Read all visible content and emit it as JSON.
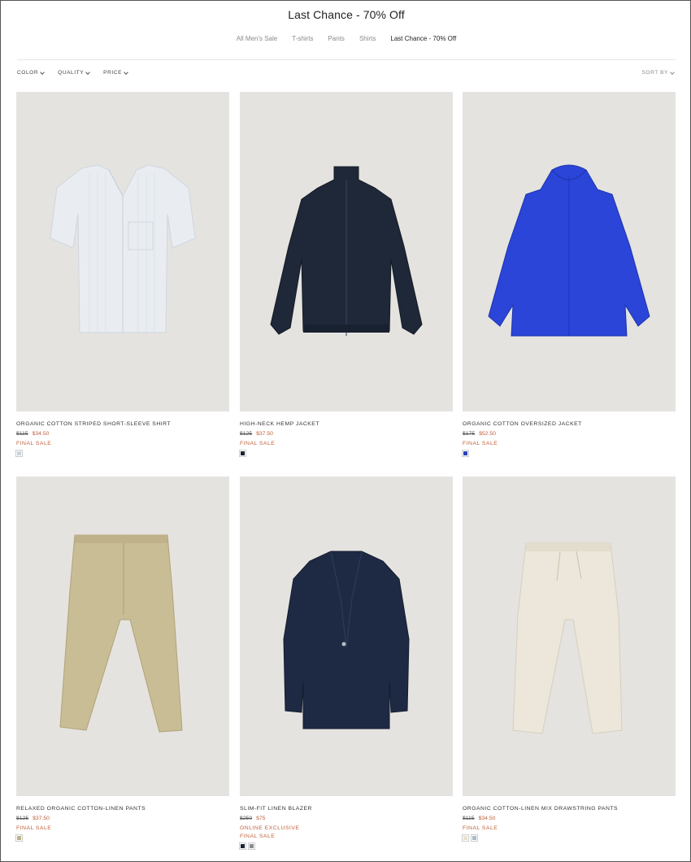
{
  "page": {
    "title": "Last Chance - 70% Off"
  },
  "category_nav": [
    {
      "label": "All Men's Sale",
      "active": false
    },
    {
      "label": "T-shirts",
      "active": false
    },
    {
      "label": "Pants",
      "active": false
    },
    {
      "label": "Shirts",
      "active": false
    },
    {
      "label": "Last Chance - 70% Off",
      "active": true
    }
  ],
  "filters": {
    "color": "COLOR",
    "quality": "QUALITY",
    "price": "PRICE",
    "sort_by": "SORT BY"
  },
  "products": [
    {
      "name": "ORGANIC COTTON STRIPED SHORT-SLEEVE SHIRT",
      "old_price": "$115",
      "new_price": "$34.50",
      "tags": [
        "FINAL SALE"
      ],
      "swatches": [
        "#c9d4df"
      ]
    },
    {
      "name": "HIGH-NECK HEMP JACKET",
      "old_price": "$125",
      "new_price": "$37.50",
      "tags": [
        "FINAL SALE"
      ],
      "swatches": [
        "#1c2433"
      ]
    },
    {
      "name": "ORGANIC COTTON OVERSIZED JACKET",
      "old_price": "$175",
      "new_price": "$52.50",
      "tags": [
        "FINAL SALE"
      ],
      "swatches": [
        "#2a43b8"
      ]
    },
    {
      "name": "RELAXED ORGANIC COTTON-LINEN PANTS",
      "old_price": "$125",
      "new_price": "$37.50",
      "tags": [
        "FINAL SALE"
      ],
      "swatches": [
        "#bfb08a"
      ]
    },
    {
      "name": "SLIM-FIT LINEN BLAZER",
      "old_price": "$250",
      "new_price": "$75",
      "tags": [
        "ONLINE EXCLUSIVE",
        "FINAL SALE"
      ],
      "swatches": [
        "#1c2433",
        "#8a8c92"
      ]
    },
    {
      "name": "ORGANIC COTTON-LINEN MIX DRAWSTRING PANTS",
      "old_price": "$115",
      "new_price": "$34.50",
      "tags": [
        "FINAL SALE"
      ],
      "swatches": [
        "#e6e1d2",
        "#a9bccd"
      ]
    }
  ],
  "colors": {
    "sale": "#c0603c",
    "image_bg": "#e5e3e0"
  }
}
